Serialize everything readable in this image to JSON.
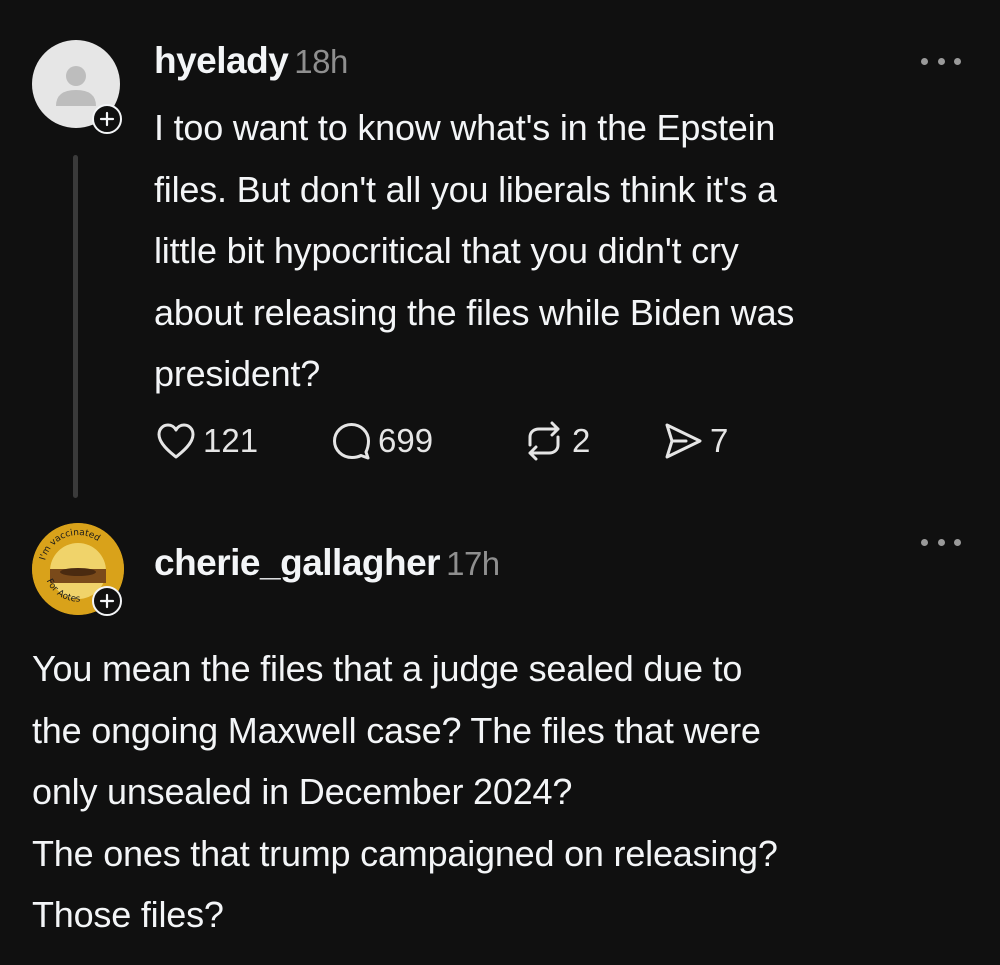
{
  "posts": [
    {
      "username": "hyelady",
      "timestamp": "18h",
      "body": "I too want to know what's in the Epstein\nfiles. But don't all you liberals think it's a\nlittle bit hypocritical that you didn't cry\nabout releasing the files while Biden was\npresident?",
      "likes": "121",
      "replies": "699",
      "reposts": "2",
      "shares": "7"
    },
    {
      "username": "cherie_gallagher",
      "timestamp": "17h",
      "avatar_text_top": "I'm vaccinated",
      "avatar_text_bottom": "For Aotes",
      "body": "You mean the files that a judge sealed due to\nthe ongoing Maxwell case? The files that were\nonly unsealed in December 2024?\nThe ones that trump campaigned on releasing?\nThose files?"
    }
  ],
  "icons": {
    "like": "heart-icon",
    "reply": "speech-bubble-icon",
    "repost": "repost-icon",
    "share": "send-icon",
    "more": "more-horizontal-icon",
    "follow": "plus-icon",
    "default_avatar": "person-icon"
  },
  "colors": {
    "background": "#101010",
    "text": "#f3f5f7",
    "secondary": "#8f8f8f",
    "thread_line": "#3a3a3a"
  }
}
